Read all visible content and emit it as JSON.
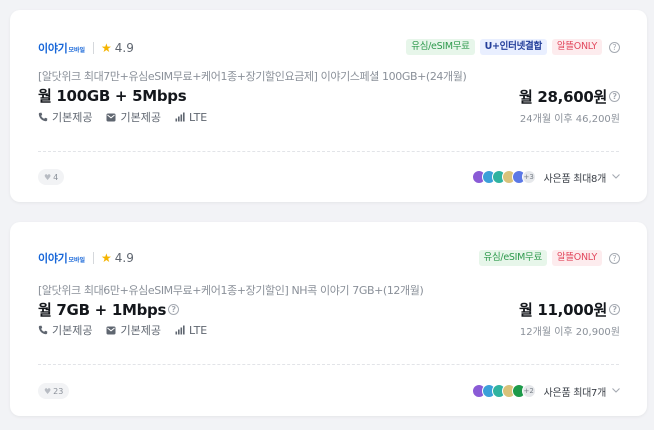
{
  "cards": [
    {
      "brand": {
        "logo": "이야기",
        "sub": "모바일"
      },
      "rating": "4.9",
      "badges": [
        "유심/eSIM무료",
        "U+인터넷결합",
        "알뜰ONLY"
      ],
      "plan_name": "[알닷위크 최대7만+유심eSIM무료+케어1종+장기할인요금제] 이야기스페셜 100GB+(24개월)",
      "plan_data": "월 100GB + 5Mbps",
      "features": [
        "기본제공",
        "기본제공",
        "LTE"
      ],
      "price": "월 28,600원",
      "price_after": "24개월 이후 46,200원",
      "likes": "4",
      "gift_more": "+3",
      "gift_label": "사은품 최대8개"
    },
    {
      "brand": {
        "logo": "이야기",
        "sub": "모바일"
      },
      "rating": "4.9",
      "badges": [
        "유심/eSIM무료",
        "알뜰ONLY"
      ],
      "plan_name": "[알닷위크 최대6만+유심eSIM무료+케어1종+장기할인] NH콕 이야기 7GB+(12개월)",
      "plan_data": "월 7GB + 1Mbps",
      "features": [
        "기본제공",
        "기본제공",
        "LTE"
      ],
      "price": "월 11,000원",
      "price_after": "12개월 이후 20,900원",
      "likes": "23",
      "gift_more": "+2",
      "gift_label": "사은품 최대7개"
    }
  ],
  "colors": {
    "brand_blue": "#1565d8",
    "star": "#f5b400",
    "badge_green_text": "#2f9a4d",
    "badge_blue_text": "#233e9a",
    "badge_red_text": "#e2475d"
  },
  "icons": {
    "rating": "star-icon",
    "call": "phone-icon",
    "sms": "message-icon",
    "network": "signal-icon",
    "like": "heart-icon",
    "help": "help-icon",
    "expand": "chevron-down-icon"
  }
}
